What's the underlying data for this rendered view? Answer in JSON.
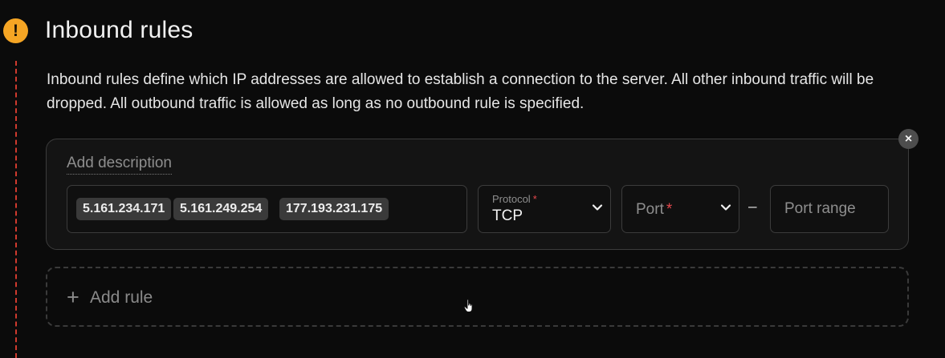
{
  "section": {
    "title": "Inbound rules",
    "description": "Inbound rules define which IP addresses are allowed to establish a connection to the server. All other inbound traffic will be dropped. All outbound traffic is allowed as long as no outbound rule is specified.",
    "warning_icon": "!"
  },
  "rule": {
    "add_description": "Add description",
    "close_icon": "×",
    "ips": [
      "5.161.234.171",
      "5.161.249.254",
      "177.193.231.175"
    ],
    "protocol": {
      "label": "Protocol",
      "required_mark": "*",
      "value": "TCP"
    },
    "port": {
      "placeholder": "Port",
      "required_mark": "*"
    },
    "range_separator": "–",
    "port_range": {
      "placeholder": "Port range",
      "value": ""
    }
  },
  "add_rule": {
    "plus": "+",
    "label": "Add rule"
  },
  "colors": {
    "warning": "#f5a524",
    "required": "#e5484d",
    "dashed_line": "#d03a2e"
  }
}
